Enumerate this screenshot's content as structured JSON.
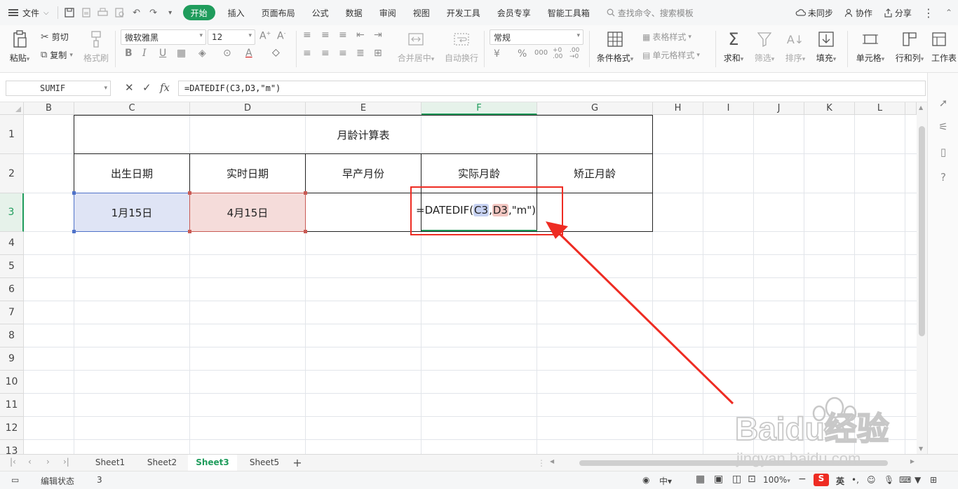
{
  "menu": {
    "file": "文件",
    "tabs": [
      "开始",
      "插入",
      "页面布局",
      "公式",
      "数据",
      "审阅",
      "视图",
      "开发工具",
      "会员专享",
      "智能工具箱"
    ],
    "active_tab": "开始",
    "search_placeholder": "查找命令、搜索模板",
    "right": {
      "sync": "未同步",
      "collab": "协作",
      "share": "分享"
    }
  },
  "ribbon": {
    "paste": "粘贴",
    "cut": "剪切",
    "copy": "复制",
    "format_painter": "格式刷",
    "font_name": "微软雅黑",
    "font_size": "12",
    "merge_center": "合并居中",
    "wrap_text": "自动换行",
    "number_format": "常规",
    "cond_format": "条件格式",
    "table_style": "表格样式",
    "cell_style": "单元格样式",
    "sum": "求和",
    "filter": "筛选",
    "sort": "排序",
    "fill": "填充",
    "cell": "单元格",
    "row_col": "行和列",
    "worksheet": "工作表"
  },
  "formula_bar": {
    "name_box": "SUMIF",
    "fx": "fx",
    "formula": "=DATEDIF(C3,D3,\"m\")"
  },
  "grid": {
    "columns": [
      "B",
      "C",
      "D",
      "E",
      "F",
      "G",
      "H",
      "I",
      "J",
      "K",
      "L"
    ],
    "selected_column": "F",
    "rows": [
      "1",
      "2",
      "3",
      "4",
      "5",
      "6",
      "7",
      "8",
      "9",
      "10",
      "11",
      "12",
      "13"
    ],
    "selected_row": "3",
    "title": "月龄计算表",
    "headers": {
      "birth_date": "出生日期",
      "current_date": "实时日期",
      "premature_months": "早产月份",
      "actual_age": "实际月龄",
      "corrected_age": "矫正月龄"
    },
    "c3": "1月15日",
    "d3": "4月15日",
    "f3_edit": {
      "prefix": "=DATEDIF(",
      "ref1": "C3",
      "comma1": ",",
      "ref2": "D3",
      "suffix": ",\"m\")"
    }
  },
  "sheets": {
    "tabs": [
      "Sheet1",
      "Sheet2",
      "Sheet3",
      "Sheet5"
    ],
    "active": "Sheet3",
    "add": "+"
  },
  "status": {
    "mode": "编辑状态",
    "value": "3",
    "zoom": "100%",
    "ime_lang": "英"
  },
  "watermark": {
    "brand": "Baidu经验",
    "url": "jingyan.baidu.com"
  },
  "colors": {
    "accent": "#1f9c5c",
    "annotation_red": "#ee2c23",
    "ref_c3": "#4f72c9",
    "ref_d3": "#c95a54"
  }
}
